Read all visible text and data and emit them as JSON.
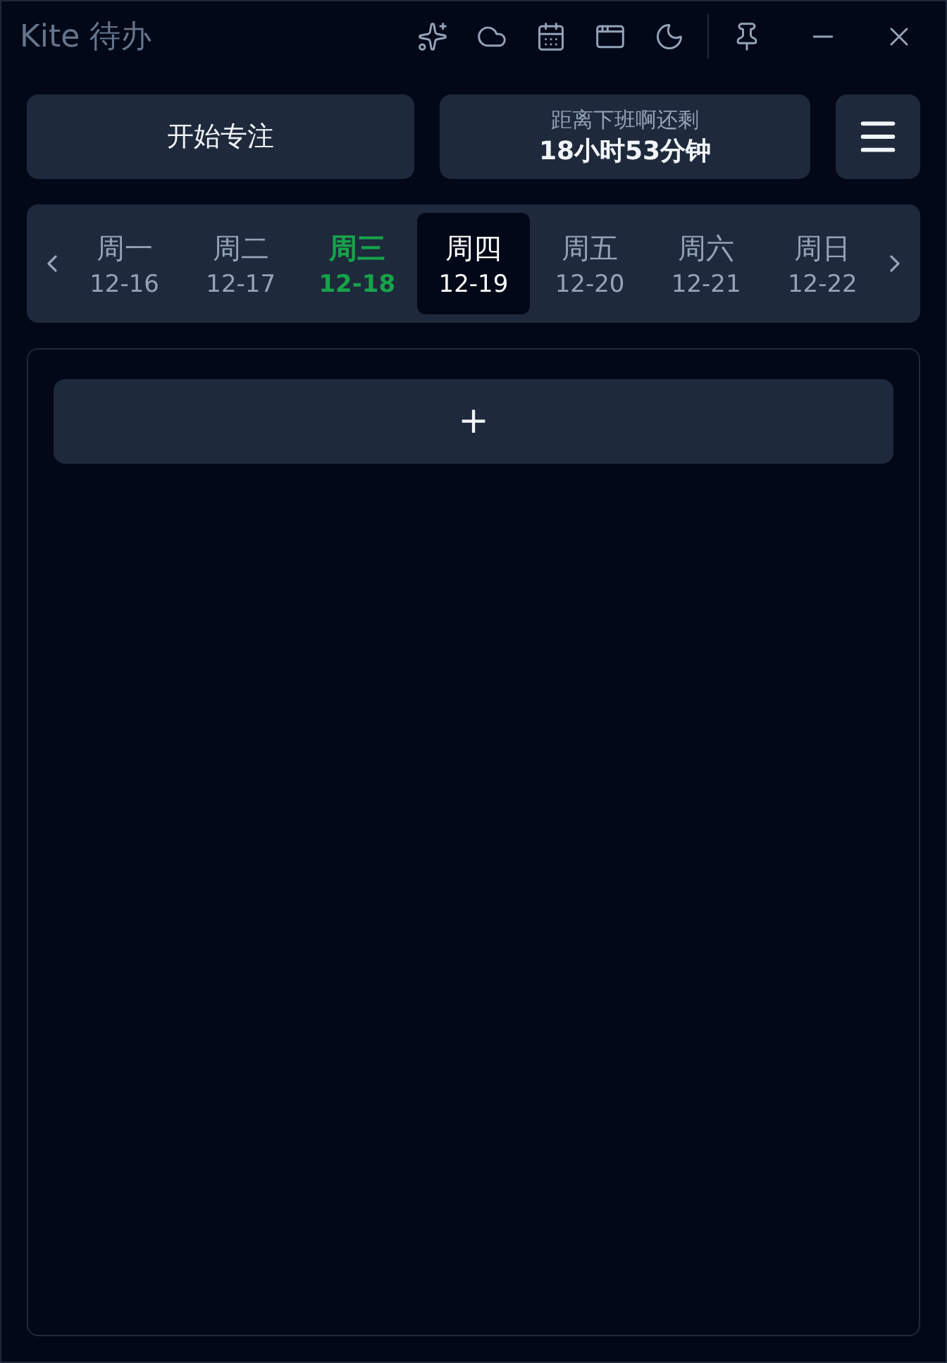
{
  "window": {
    "title": "Kite 待办"
  },
  "focus_button": {
    "label": "开始专注"
  },
  "countdown": {
    "caption": "距离下班啊还剩",
    "value": "18小时53分钟"
  },
  "week": [
    {
      "weekday": "周一",
      "date": "12-16",
      "today": false,
      "selected": false
    },
    {
      "weekday": "周二",
      "date": "12-17",
      "today": false,
      "selected": false
    },
    {
      "weekday": "周三",
      "date": "12-18",
      "today": true,
      "selected": false
    },
    {
      "weekday": "周四",
      "date": "12-19",
      "today": false,
      "selected": true
    },
    {
      "weekday": "周五",
      "date": "12-20",
      "today": false,
      "selected": false
    },
    {
      "weekday": "周六",
      "date": "12-21",
      "today": false,
      "selected": false
    },
    {
      "weekday": "周日",
      "date": "12-22",
      "today": false,
      "selected": false
    }
  ],
  "add_button": {
    "label": "+"
  }
}
